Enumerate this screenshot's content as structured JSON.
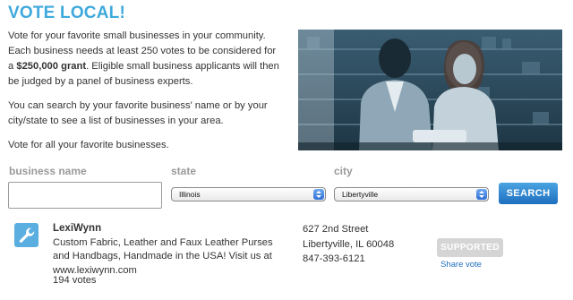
{
  "header": {
    "title": "VOTE LOCAL!"
  },
  "intro": {
    "p1_before": "Vote for your favorite small businesses in your community. Each business needs at least 250 votes to be considered for a ",
    "p1_bold": "$250,000 grant",
    "p1_after": ". Eligible small business applicants will then be judged by a panel of business experts.",
    "p2": "You can search by your favorite business' name or by your city/state to see a list of businesses in your area.",
    "p3": "Vote for all your favorite businesses."
  },
  "search": {
    "name_label": "business name",
    "name_value": "",
    "state_label": "state",
    "state_value": "Illinois",
    "city_label": "city",
    "city_value": "Libertyville",
    "button_label": "SEARCH"
  },
  "result": {
    "icon": "wrench-icon",
    "name": "LexiWynn",
    "description": "Custom Fabric, Leather and Faux Leather Purses and Handbags, Handmade in the USA! Visit us at www.lexiwynn.com",
    "votes": "194 votes",
    "address_line1": "627 2nd Street",
    "address_line2": "Libertyville, IL 60048",
    "phone": "847-393-6121",
    "supported_label": "SUPPORTED",
    "share_label": "Share vote"
  },
  "colors": {
    "accent": "#3fa9dc",
    "button": "#1f6fbf",
    "disabled": "#d5d5d5"
  }
}
